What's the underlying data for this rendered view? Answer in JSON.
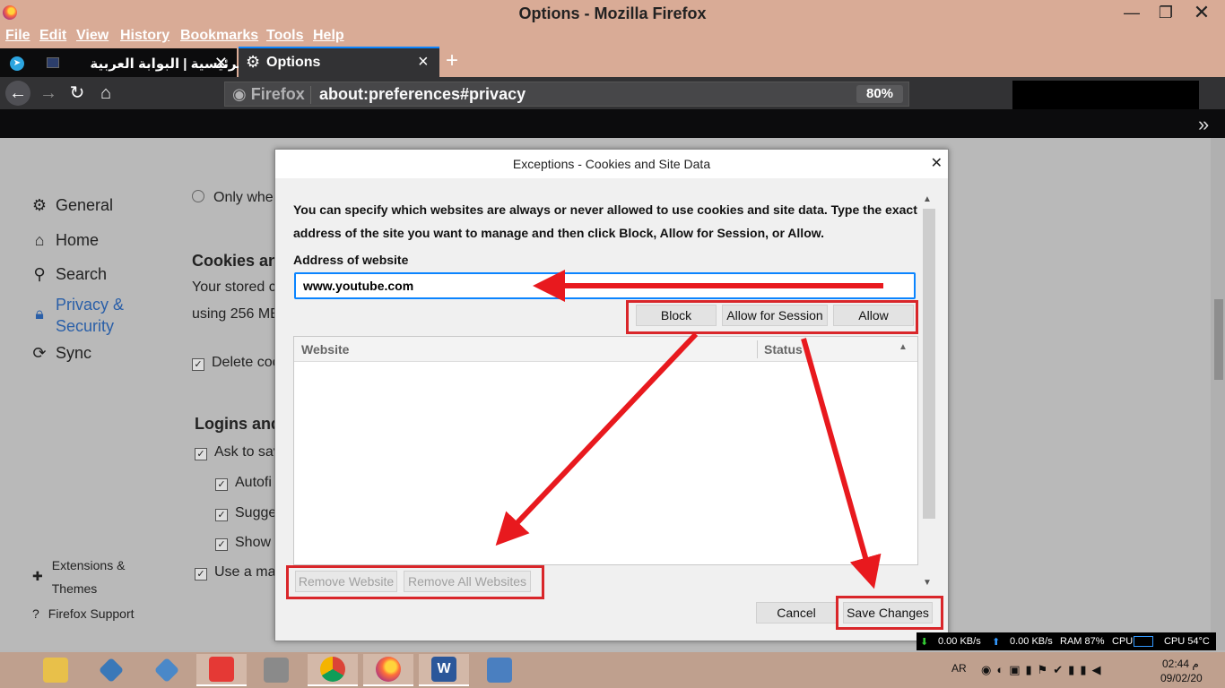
{
  "window": {
    "title": "Options - Mozilla Firefox",
    "controls": {
      "minimize": "—",
      "maximize": "❐",
      "close": "✕"
    }
  },
  "menu": [
    "File",
    "Edit",
    "View",
    "History",
    "Bookmarks",
    "Tools",
    "Help"
  ],
  "tabs": [
    {
      "label": "الرئيسية | البوابة العربية"
    },
    {
      "label": "Options"
    }
  ],
  "nav": {
    "identity": "Firefox",
    "url": "about:preferences#privacy",
    "zoom": "80%"
  },
  "sidebar": {
    "items": [
      {
        "label": "General",
        "icon": "gear-icon"
      },
      {
        "label": "Home",
        "icon": "home-icon"
      },
      {
        "label": "Search",
        "icon": "search-icon"
      },
      {
        "label": "Privacy &",
        "label2": "Security",
        "icon": "lock-icon"
      },
      {
        "label": "Sync",
        "icon": "sync-icon"
      }
    ],
    "footer": [
      {
        "label": "Extensions &",
        "label2": "Themes",
        "icon": "puzzle-icon"
      },
      {
        "label": "Firefox Support",
        "icon": "help-icon"
      }
    ]
  },
  "pane": {
    "only_when": "Only whe",
    "cookies_heading": "Cookies and",
    "stored_line": "Your stored c",
    "using_line": "using 256 ME",
    "delete_cookies": "Delete coo",
    "logins_heading": "Logins and",
    "ask_to_save": "Ask to sav",
    "autofill": "Autofi",
    "suggest": "Sugge",
    "show": "Show",
    "use_master": "Use a mas"
  },
  "dialog": {
    "title": "Exceptions - Cookies and Site Data",
    "description": "You can specify which websites are always or never allowed to use cookies and site data. Type the exact address of the site you want to manage and then click Block, Allow for Session, or Allow.",
    "address_label": "Address of website",
    "address_value": "www.youtube.com",
    "buttons": {
      "block": "Block",
      "allow_session": "Allow for Session",
      "allow": "Allow"
    },
    "table": {
      "col_website": "Website",
      "col_status": "Status",
      "rows": []
    },
    "remove_website": "Remove Website",
    "remove_all": "Remove All Websites",
    "cancel": "Cancel",
    "save": "Save Changes"
  },
  "taskbar": {
    "apps": [
      "file-explorer",
      "app-2",
      "app-3",
      "app-4",
      "app-5",
      "chrome",
      "firefox",
      "word",
      "app-9"
    ],
    "language": "AR",
    "clock": "02:44 م",
    "date": "09/02/20"
  },
  "netmeter": {
    "down": "0.00 KB/s",
    "up": "0.00 KB/s",
    "ram": "RAM 87%",
    "cpu_label": "CPU",
    "cpu_temp": "CPU 54°C"
  },
  "colors": {
    "annotation_red": "#d9262a",
    "accent_blue": "#0a84ff"
  }
}
